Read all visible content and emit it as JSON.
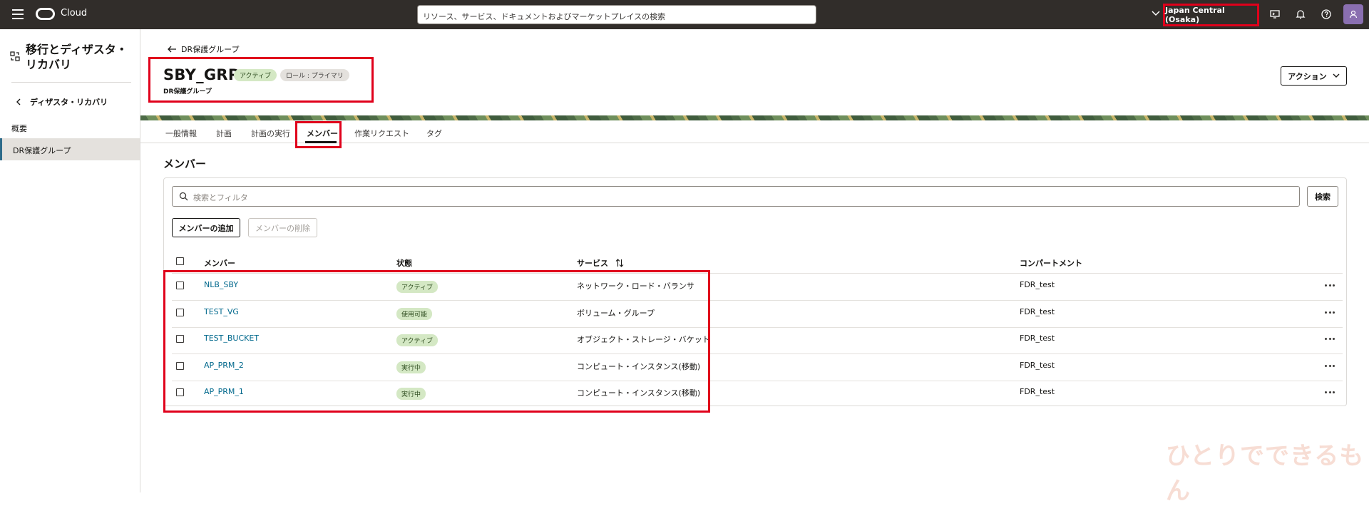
{
  "topbar": {
    "brand": "Cloud",
    "search_placeholder": "リソース、サービス、ドキュメントおよびマーケットプレイスの検索",
    "region": "Japan Central (Osaka)"
  },
  "sidebar": {
    "title": "移行とディザスタ・リカバリ",
    "back_label": "ディザスタ・リカバリ",
    "items": [
      {
        "label": "概要"
      },
      {
        "label": "DR保護グループ"
      }
    ]
  },
  "header": {
    "back_label": "DR保護グループ",
    "title": "SBY_GRP",
    "status_badge": "アクティブ",
    "role_badge": "ロール : プライマリ",
    "subtitle": "DR保護グループ",
    "action_label": "アクション"
  },
  "tabs": [
    {
      "label": "一般情報"
    },
    {
      "label": "計画"
    },
    {
      "label": "計画の実行"
    },
    {
      "label": "メンバー"
    },
    {
      "label": "作業リクエスト"
    },
    {
      "label": "タグ"
    }
  ],
  "members": {
    "section_title": "メンバー",
    "filter_placeholder": "検索とフィルタ",
    "search_label": "検索",
    "add_label": "メンバーの追加",
    "remove_label": "メンバーの削除",
    "columns": {
      "member": "メンバー",
      "state": "状態",
      "service": "サービス",
      "compartment": "コンパートメント"
    },
    "rows": [
      {
        "name": "NLB_SBY",
        "state": "アクティブ",
        "service": "ネットワーク・ロード・バランサ",
        "compartment": "FDR_test"
      },
      {
        "name": "TEST_VG",
        "state": "使用可能",
        "service": "ボリューム・グループ",
        "compartment": "FDR_test"
      },
      {
        "name": "TEST_BUCKET",
        "state": "アクティブ",
        "service": "オブジェクト・ストレージ・バケット",
        "compartment": "FDR_test"
      },
      {
        "name": "AP_PRM_2",
        "state": "実行中",
        "service": "コンピュート・インスタンス(移動)",
        "compartment": "FDR_test"
      },
      {
        "name": "AP_PRM_1",
        "state": "実行中",
        "service": "コンピュート・インスタンス(移動)",
        "compartment": "FDR_test"
      }
    ]
  },
  "watermark": "ひとりでできるもん"
}
